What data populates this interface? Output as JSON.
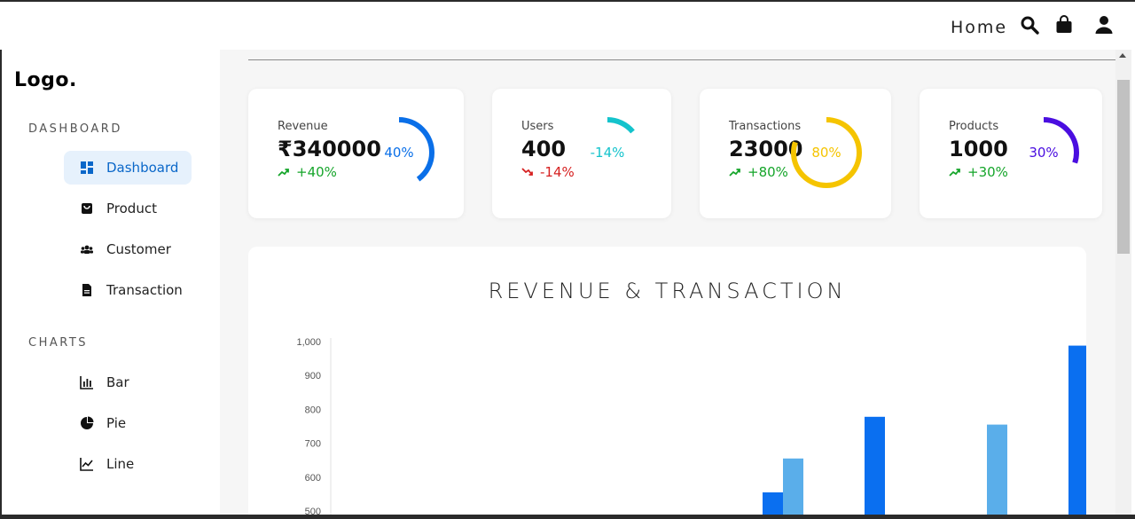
{
  "topnav": {
    "home_label": "Home",
    "icons": [
      "search-icon",
      "shopping-bag-icon",
      "user-icon"
    ]
  },
  "sidebar": {
    "logo": "Logo.",
    "sections": [
      {
        "title": "DASHBOARD",
        "items": [
          {
            "label": "Dashboard",
            "icon": "dashboard-icon",
            "active": true
          },
          {
            "label": "Product",
            "icon": "bag-icon",
            "active": false
          },
          {
            "label": "Customer",
            "icon": "people-icon",
            "active": false
          },
          {
            "label": "Transaction",
            "icon": "document-icon",
            "active": false
          }
        ]
      },
      {
        "title": "CHARTS",
        "items": [
          {
            "label": "Bar",
            "icon": "bar-chart-icon",
            "active": false
          },
          {
            "label": "Pie",
            "icon": "pie-chart-icon",
            "active": false
          },
          {
            "label": "Line",
            "icon": "line-chart-icon",
            "active": false
          }
        ]
      }
    ]
  },
  "stats": [
    {
      "label": "Revenue",
      "value": "₹340000",
      "change": "+40%",
      "trend": "up",
      "ring_percent": 40,
      "ring_label": "40%",
      "color": "#0a6fe8"
    },
    {
      "label": "Users",
      "value": "400",
      "change": "-14%",
      "trend": "down",
      "ring_percent": 14,
      "ring_label": "-14%",
      "color": "#14c3cc"
    },
    {
      "label": "Transactions",
      "value": "23000",
      "change": "+80%",
      "trend": "up",
      "ring_percent": 80,
      "ring_label": "80%",
      "color": "#f5c400"
    },
    {
      "label": "Products",
      "value": "1000",
      "change": "+30%",
      "trend": "up",
      "ring_percent": 30,
      "ring_label": "30%",
      "color": "#4a0ee0"
    }
  ],
  "colors": {
    "up": "#15a52a",
    "down": "#d62020",
    "active_bg": "#e6f1fc",
    "active_text": "#0a67c9",
    "revenue_bar": "#0a6ff0",
    "transaction_bar": "#5aaeea"
  },
  "chart_data": {
    "type": "bar",
    "title": "REVENUE & TRANSACTION",
    "ylim": [
      500,
      1000
    ],
    "yticks": [
      500,
      600,
      700,
      800,
      900,
      1000
    ],
    "ytick_labels": [
      "500",
      "600",
      "700",
      "800",
      "900",
      "1,000"
    ],
    "grid": false,
    "series": [
      {
        "values": [
          null,
          null,
          null,
          null,
          555,
          778,
          null,
          988
        ]
      },
      {
        "values": [
          null,
          null,
          null,
          null,
          655,
          null,
          755,
          null
        ]
      }
    ]
  }
}
